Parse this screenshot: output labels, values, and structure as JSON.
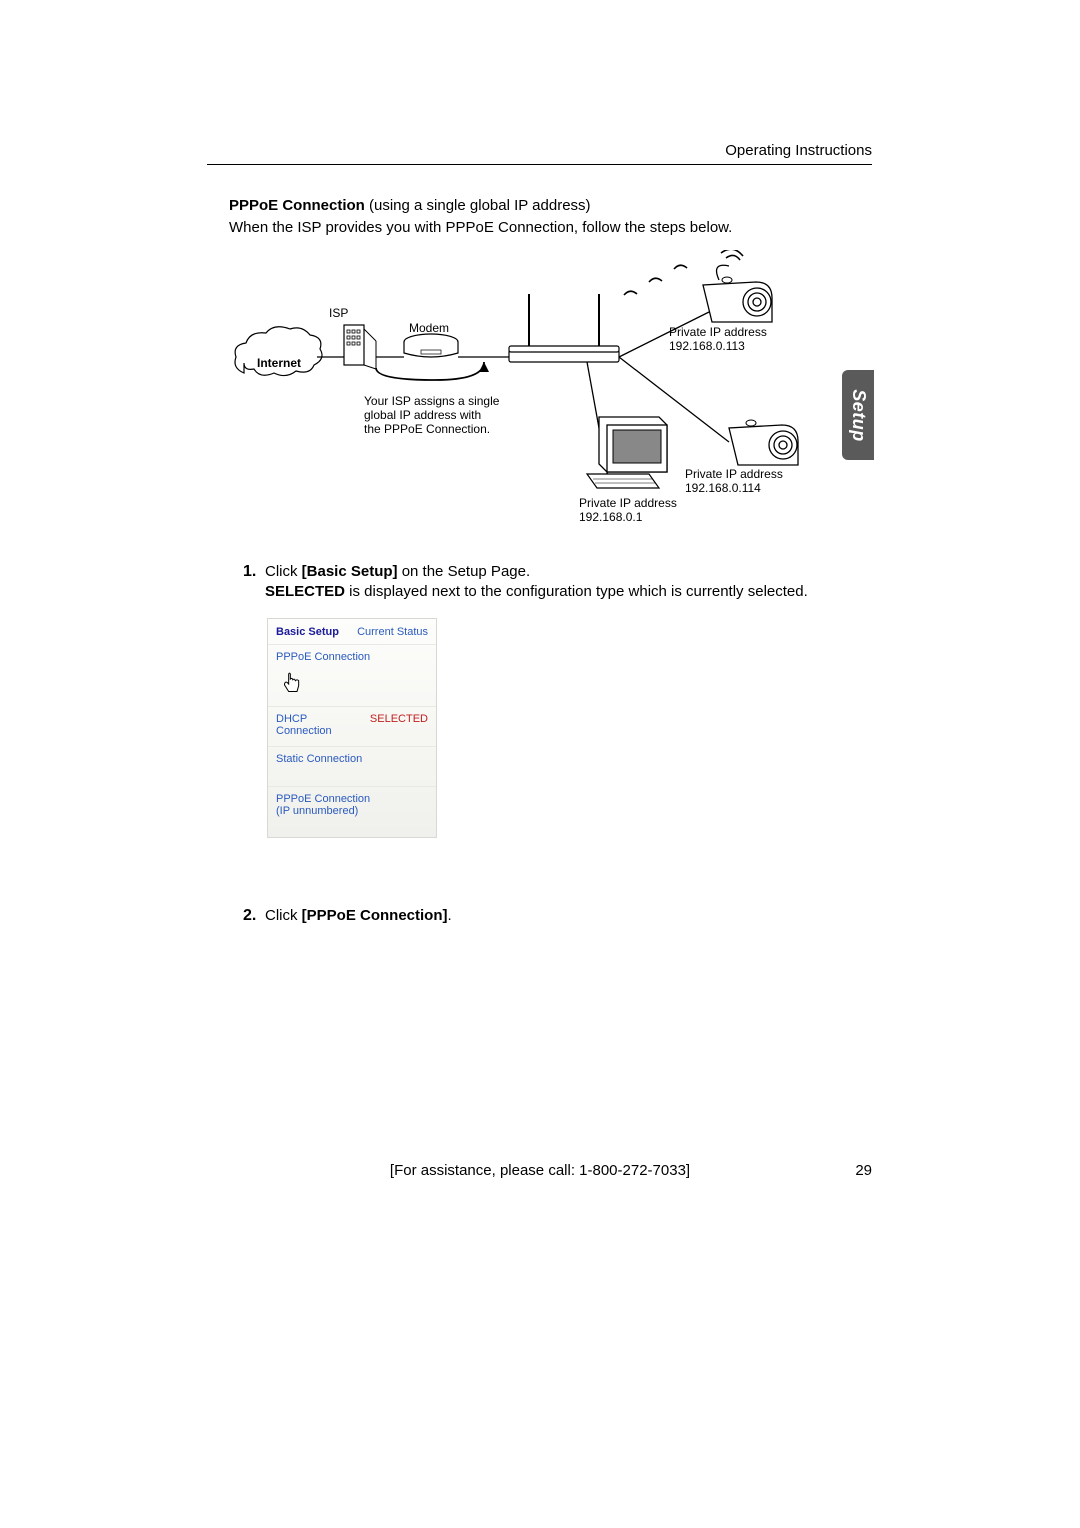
{
  "header": "Operating Instructions",
  "title_bold": "PPPoE Connection",
  "title_rest": " (using a single global IP address)",
  "subtitle": "When the ISP provides you with PPPoE Connection, follow the steps below.",
  "diagram": {
    "isp": "ISP",
    "modem": "Modem",
    "internet": "Internet",
    "cam1_label1": "Private IP address",
    "cam1_label2": "192.168.0.113",
    "cam2_label1": "Private IP address",
    "cam2_label2": "192.168.0.114",
    "pc_label1": "Private IP address",
    "pc_label2": "192.168.0.1",
    "note_l1": "Your ISP assigns a single",
    "note_l2": "global IP address with",
    "note_l3": "the PPPoE Connection."
  },
  "step1": {
    "num": "1.",
    "line1_a": "Click ",
    "line1_b": "[Basic Setup]",
    "line1_c": " on the Setup Page.",
    "line2_a": "SELECTED",
    "line2_b": " is displayed next to the configuration type which is currently selected."
  },
  "step2": {
    "num": "2.",
    "line_a": "Click ",
    "line_b": "[PPPoE Connection]",
    "line_c": "."
  },
  "ui": {
    "heading": "Basic Setup",
    "status": "Current Status",
    "pppoe": "PPPoE Connection",
    "dhcp": "DHCP Connection",
    "selected": "SELECTED",
    "static": "Static Connection",
    "pppoe_unnum1": "PPPoE Connection",
    "pppoe_unnum2": "(IP unnumbered)"
  },
  "side_tab": "Setup",
  "footer": "[For assistance, please call: 1-800-272-7033]",
  "page_number": "29"
}
